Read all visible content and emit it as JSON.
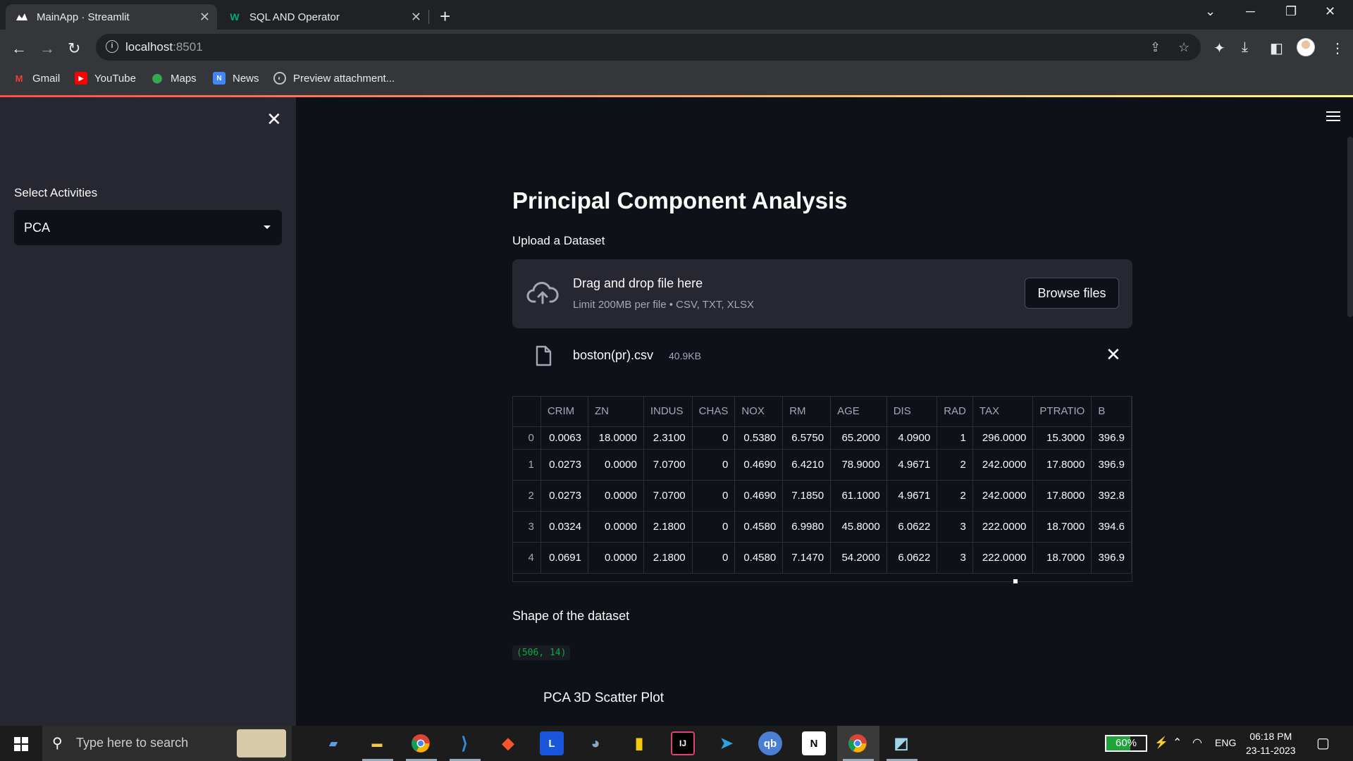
{
  "browser": {
    "tabs": [
      {
        "title": "MainApp · Streamlit",
        "active": true
      },
      {
        "title": "SQL AND Operator",
        "active": false
      }
    ],
    "url_host": "localhost",
    "url_port": ":8501",
    "bookmarks": [
      "Gmail",
      "YouTube",
      "Maps",
      "News",
      "Preview attachment..."
    ]
  },
  "sidebar": {
    "label": "Select Activities",
    "selected": "PCA"
  },
  "main": {
    "title": "Principal Component Analysis",
    "upload_label": "Upload a Dataset",
    "dropzone_title": "Drag and drop file here",
    "dropzone_limit": "Limit 200MB per file • CSV, TXT, XLSX",
    "browse_label": "Browse files",
    "file_name": "boston(pr).csv",
    "file_size": "40.9KB",
    "table": {
      "columns": [
        "",
        "CRIM",
        "ZN",
        "INDUS",
        "CHAS",
        "NOX",
        "RM",
        "AGE",
        "DIS",
        "RAD",
        "TAX",
        "PTRATIO",
        "B"
      ],
      "rows": [
        [
          "0",
          "0.0063",
          "18.0000",
          "2.3100",
          "0",
          "0.5380",
          "6.5750",
          "65.2000",
          "4.0900",
          "1",
          "296.0000",
          "15.3000",
          "396.9"
        ],
        [
          "1",
          "0.0273",
          "0.0000",
          "7.0700",
          "0",
          "0.4690",
          "6.4210",
          "78.9000",
          "4.9671",
          "2",
          "242.0000",
          "17.8000",
          "396.9"
        ],
        [
          "2",
          "0.0273",
          "0.0000",
          "7.0700",
          "0",
          "0.4690",
          "7.1850",
          "61.1000",
          "4.9671",
          "2",
          "242.0000",
          "17.8000",
          "392.8"
        ],
        [
          "3",
          "0.0324",
          "0.0000",
          "2.1800",
          "0",
          "0.4580",
          "6.9980",
          "45.8000",
          "6.0622",
          "3",
          "222.0000",
          "18.7000",
          "394.6"
        ],
        [
          "4",
          "0.0691",
          "0.0000",
          "2.1800",
          "0",
          "0.4580",
          "7.1470",
          "54.2000",
          "6.0622",
          "3",
          "222.0000",
          "18.7000",
          "396.9"
        ]
      ]
    },
    "shape_label": "Shape of the dataset",
    "shape_value": "(506, 14)",
    "plot_title": "PCA 3D Scatter Plot"
  },
  "taskbar": {
    "search_placeholder": "Type here to search",
    "battery": "60%",
    "language": "ENG",
    "time": "06:18 PM",
    "date": "23-11-2023"
  }
}
